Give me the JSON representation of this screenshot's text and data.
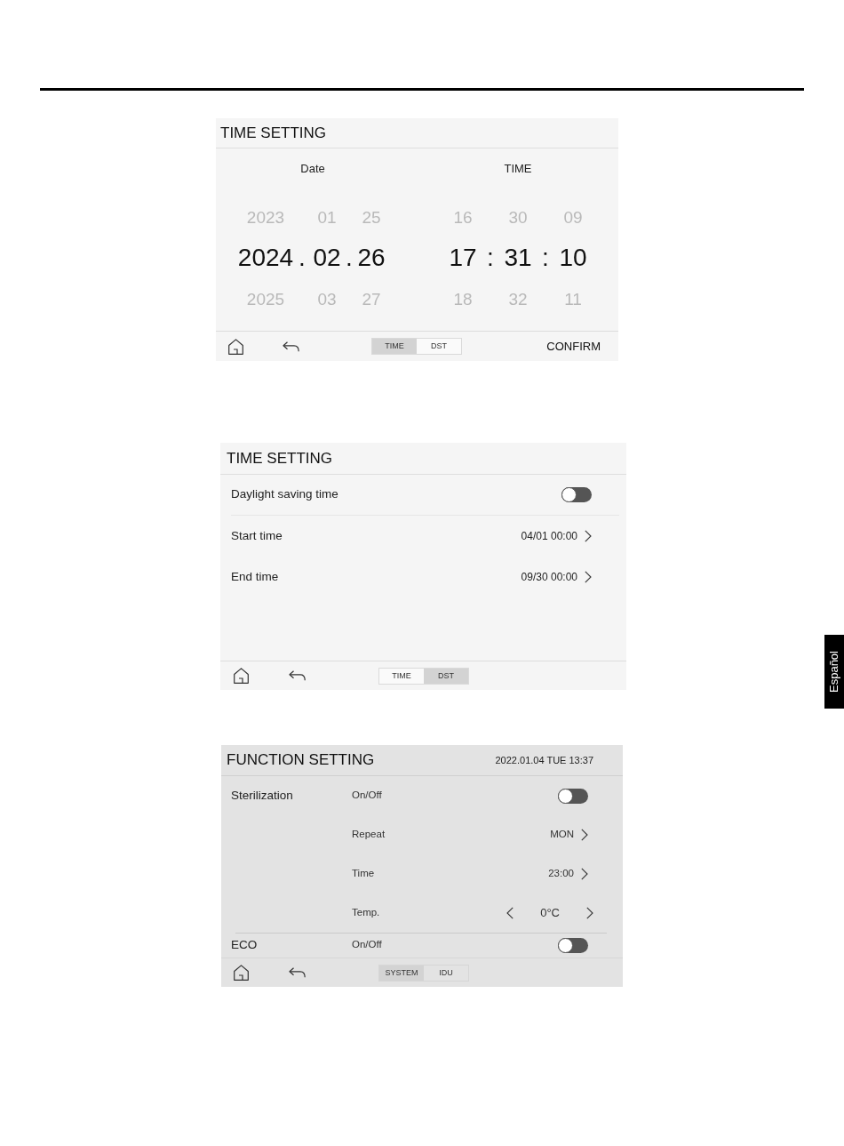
{
  "time_screen": {
    "title": "TIME SETTING",
    "pickers": [
      {
        "label": "Date",
        "wheels": [
          {
            "prev": "2023",
            "current": "2024",
            "next": "2025"
          },
          {
            "prev": "01",
            "current": "02",
            "next": "03"
          },
          {
            "prev": "25",
            "current": "26",
            "next": "27"
          }
        ],
        "separators": [
          ".",
          "."
        ]
      },
      {
        "label": "TIME",
        "wheels": [
          {
            "prev": "16",
            "current": "17",
            "next": "18"
          },
          {
            "prev": "30",
            "current": "31",
            "next": "32"
          },
          {
            "prev": "09",
            "current": "10",
            "next": "11"
          }
        ],
        "separators": [
          ":",
          ":"
        ]
      }
    ],
    "tabs": [
      {
        "label": "TIME",
        "selected": true
      },
      {
        "label": "DST",
        "selected": false
      }
    ],
    "confirm": "CONFIRM"
  },
  "dst_screen": {
    "title": "TIME SETTING",
    "rows": [
      {
        "kind": "toggle",
        "label": "Daylight saving time",
        "on": false
      },
      {
        "kind": "link",
        "label": "Start time",
        "value": "04/01 00:00"
      },
      {
        "kind": "link",
        "label": "End time",
        "value": "09/30 00:00"
      }
    ],
    "tabs": [
      {
        "label": "TIME",
        "selected": false
      },
      {
        "label": "DST",
        "selected": true
      }
    ]
  },
  "function_screen": {
    "title": "FUNCTION SETTING",
    "datetime": "2022.01.04 TUE 13:37",
    "groups": [
      {
        "name": "Sterilization",
        "rows": [
          {
            "kind": "toggle",
            "label": "On/Off",
            "on": false
          },
          {
            "kind": "link",
            "label": "Repeat",
            "value": "MON"
          },
          {
            "kind": "link",
            "label": "Time",
            "value": "23:00"
          },
          {
            "kind": "stepper",
            "label": "Temp.",
            "value": "0°C"
          }
        ]
      },
      {
        "name": "ECO",
        "rows": [
          {
            "kind": "toggle",
            "label": "On/Off",
            "on": false
          }
        ]
      }
    ],
    "tabs": [
      {
        "label": "SYSTEM",
        "selected": true
      },
      {
        "label": "IDU",
        "selected": false
      }
    ]
  },
  "side_tab": {
    "label": "Español"
  }
}
